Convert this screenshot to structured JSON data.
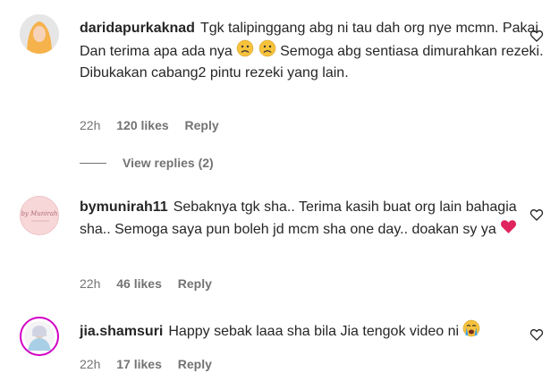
{
  "comments": [
    {
      "username": "daridapurkaknad",
      "text_parts": [
        "Tgk talipinggang abg ni tau dah org nye mcmn. Pakai Dan terima apa ada nya ",
        " Semoga abg sentiasa dimurahkan rezeki. Dibukakan cabang2 pintu rezeki yang lain."
      ],
      "emojis": [
        "sad-face-emoji",
        "sad-face-emoji"
      ],
      "time": "22h",
      "likes": "120 likes",
      "reply": "Reply",
      "avatar_icon": "hijab-avatar",
      "view_replies": "View replies (2)"
    },
    {
      "username": "bymunirah11",
      "text_parts": [
        "Sebaknya tgk sha.. Terima kasih buat org lain bahagia sha.. Semoga saya pun boleh jd mcm sha one day.. doakan sy ya "
      ],
      "emojis": [
        "red-heart-emoji"
      ],
      "time": "22h",
      "likes": "46 likes",
      "reply": "Reply",
      "avatar_icon": "logo-avatar",
      "avatar_logo_text": "by Munirah"
    },
    {
      "username": "jia.shamsuri",
      "text_parts": [
        "Happy sebak laaa sha bila Jia tengok video ni "
      ],
      "emojis": [
        "crying-face-emoji"
      ],
      "time": "22h",
      "likes": "17 likes",
      "reply": "Reply",
      "avatar_icon": "ring-avatar"
    }
  ],
  "colors": {
    "text": "#262626",
    "meta": "#737373",
    "heart": "#e0245e",
    "avatar_ring": "#d300c5",
    "avatar_bg_pink": "#f8d7d9",
    "avatar_hijab": "#f6b24b"
  }
}
